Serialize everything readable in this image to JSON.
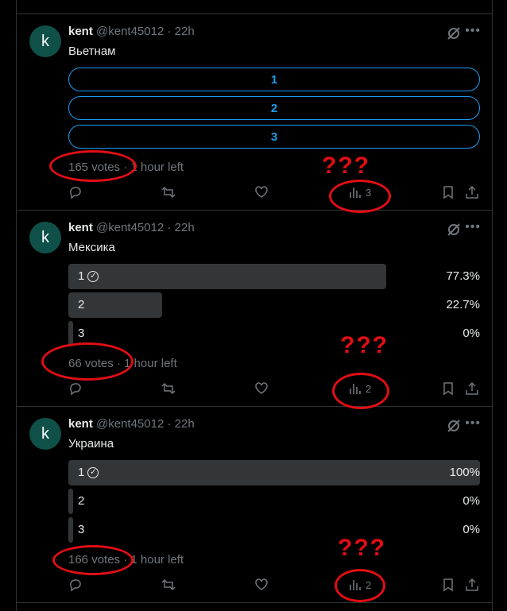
{
  "tweets": [
    {
      "avatar_letter": "k",
      "name": "kent",
      "handle": "@kent45012 · 22h",
      "text": "Вьетнам",
      "poll_options": [
        "1",
        "2",
        "3"
      ],
      "votes": "165 votes",
      "time_left": " · 1 hour left",
      "views": "3"
    },
    {
      "avatar_letter": "k",
      "name": "kent",
      "handle": "@kent45012 · 22h",
      "text": "Мексика",
      "results": [
        {
          "label": "1",
          "pct": "77.3%",
          "winner": true,
          "fraction": 0.773
        },
        {
          "label": "2",
          "pct": "22.7%",
          "winner": false,
          "fraction": 0.227
        },
        {
          "label": "3",
          "pct": "0%",
          "winner": false,
          "fraction": 0
        }
      ],
      "votes": "66 votes",
      "time_left": " · 1 hour left",
      "views": "2"
    },
    {
      "avatar_letter": "k",
      "name": "kent",
      "handle": "@kent45012 · 22h",
      "text": "Украина",
      "results": [
        {
          "label": "1",
          "pct": "100%",
          "winner": true,
          "fraction": 1.0
        },
        {
          "label": "2",
          "pct": "0%",
          "winner": false,
          "fraction": 0
        },
        {
          "label": "3",
          "pct": "0%",
          "winner": false,
          "fraction": 0
        }
      ],
      "votes": "166 votes",
      "time_left": " · 1 hour left",
      "views": "2"
    }
  ],
  "annotation": {
    "marks": "???",
    "color": "#e10e14"
  },
  "colors": {
    "accent": "#1d9bf0",
    "avatar": "#0f5148",
    "muted": "#71767b",
    "bar": "#333639"
  }
}
